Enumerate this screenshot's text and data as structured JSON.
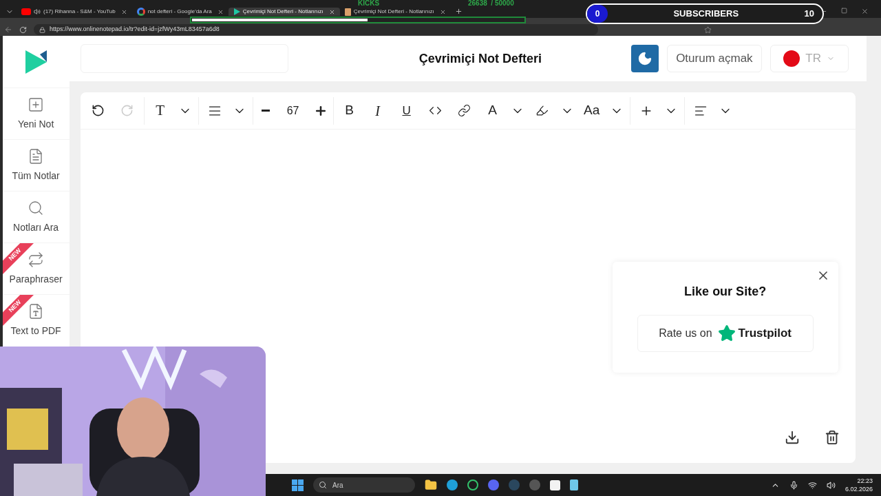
{
  "browser": {
    "tabs": [
      {
        "title": "(17) Rihanna - S&M - YouTub",
        "kind": "youtube",
        "audio": true,
        "selected": false
      },
      {
        "title": "not defteri - Google'da Ara",
        "kind": "google",
        "audio": false,
        "selected": false
      },
      {
        "title": "Çevrimiçi Not Defteri - Notlarınızı",
        "kind": "notepad",
        "audio": false,
        "selected": true
      },
      {
        "title": "Çevrimiçi Not Defteri - Notlarınızı",
        "kind": "page",
        "audio": false,
        "selected": false
      }
    ],
    "url": "https://www.onlinenotepad.io/tr?edit-id=jzfWy43mL83457a6d8"
  },
  "stream_overlay": {
    "kicks": {
      "label": "KICKS",
      "count": "26638",
      "goal": "/ 50000",
      "level": 0.53
    },
    "subscribers": {
      "current": "0",
      "label": "SUBSCRIBERS",
      "goal": "10"
    }
  },
  "sidebar": {
    "items": [
      {
        "label": "Yeni Not",
        "kind": "new"
      },
      {
        "label": "Tüm Notlar",
        "kind": "notes"
      },
      {
        "label": "Notları Ara",
        "kind": "search"
      },
      {
        "label": "Paraphraser",
        "kind": "paraphrase",
        "badge": "NEW"
      },
      {
        "label": "Text to PDF",
        "kind": "pdf",
        "badge": "NEW"
      }
    ]
  },
  "header": {
    "title": "Çevrimiçi Not Defteri",
    "login": "Oturum açmak",
    "language": "TR",
    "dark_mode": false
  },
  "toolbar": {
    "groups": [
      [
        {
          "kind": "undo",
          "disabled": false
        },
        {
          "kind": "redo",
          "disabled": true
        }
      ],
      [
        {
          "kind": "glyph",
          "label": "T",
          "serif": true
        },
        {
          "kind": "caret"
        }
      ],
      [
        {
          "kind": "align"
        },
        {
          "kind": "caret"
        }
      ],
      [
        {
          "kind": "minus"
        },
        {
          "kind": "size",
          "label": "67"
        },
        {
          "kind": "plus"
        }
      ],
      [
        {
          "kind": "glyph",
          "label": "B",
          "serif": false
        },
        {
          "kind": "italic",
          "label": "I"
        },
        {
          "kind": "underline",
          "label": "U"
        },
        {
          "kind": "code"
        },
        {
          "kind": "link"
        },
        {
          "kind": "glyph",
          "label": "A",
          "serif": false
        },
        {
          "kind": "caret"
        },
        {
          "kind": "highlight"
        },
        {
          "kind": "caret"
        },
        {
          "kind": "glyph",
          "label": "Aa",
          "serif": false
        },
        {
          "kind": "caret"
        }
      ],
      [
        {
          "kind": "plus_thin"
        },
        {
          "kind": "caret"
        }
      ],
      [
        {
          "kind": "align_left"
        },
        {
          "kind": "caret"
        }
      ]
    ]
  },
  "rate_popup": {
    "title": "Like our Site?",
    "prompt": "Rate us on",
    "brand": "Trustpilot"
  },
  "taskbar": {
    "search": "Ara",
    "time": "22:23",
    "date": "6.02.2026"
  }
}
